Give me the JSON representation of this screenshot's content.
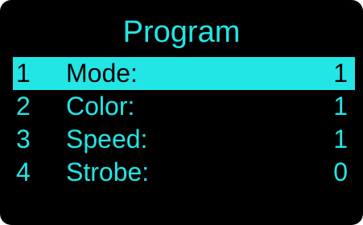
{
  "screen": {
    "title": "Program",
    "accent_color": "#22e6e6",
    "background_color": "#000000",
    "selected_index": 0
  },
  "menu": {
    "items": [
      {
        "number": "1",
        "label": "Mode:",
        "value": "1"
      },
      {
        "number": "2",
        "label": "Color:",
        "value": "1"
      },
      {
        "number": "3",
        "label": "Speed:",
        "value": "1"
      },
      {
        "number": "4",
        "label": "Strobe:",
        "value": "0"
      }
    ]
  }
}
